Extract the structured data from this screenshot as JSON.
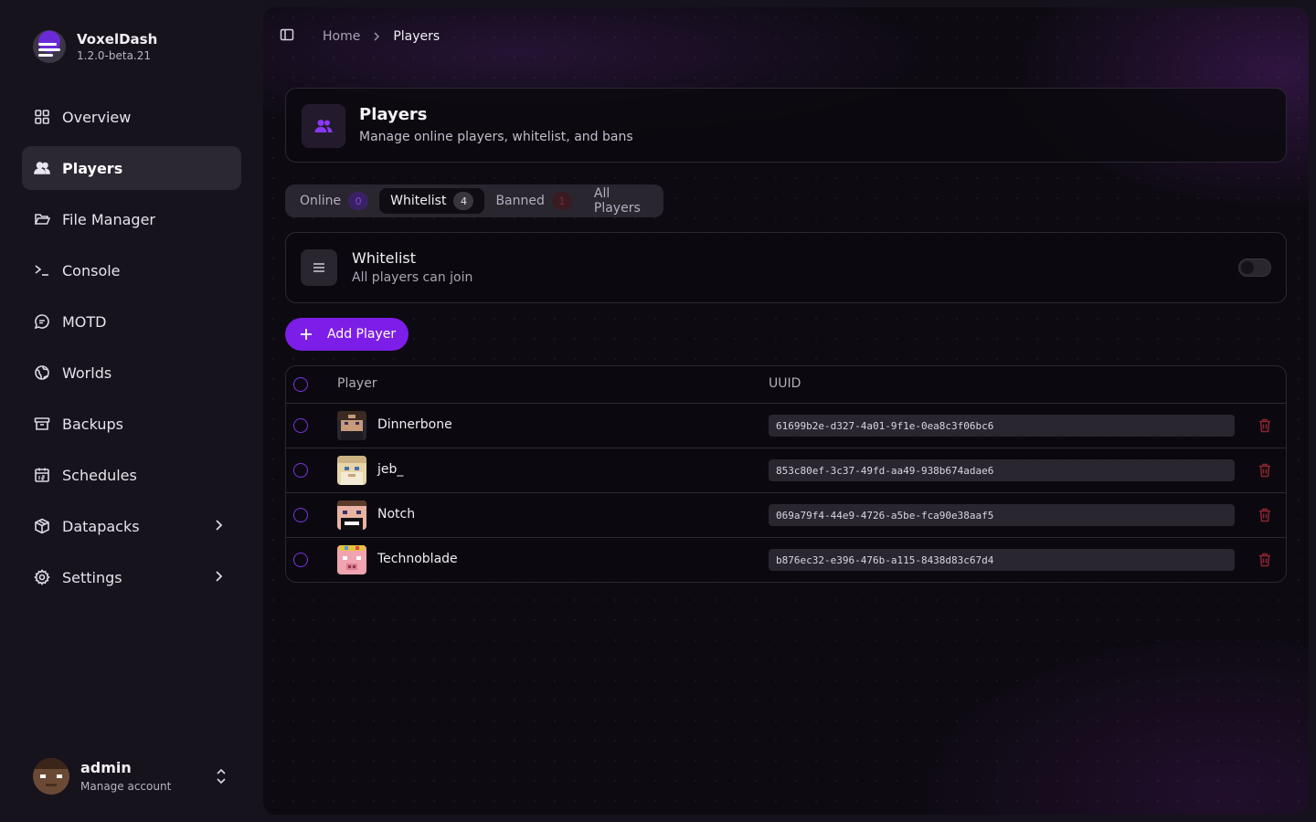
{
  "app": {
    "name": "VoxelDash",
    "version": "1.2.0-beta.21"
  },
  "sidebar": {
    "items": [
      {
        "label": "Overview",
        "icon": "grid-icon"
      },
      {
        "label": "Players",
        "icon": "users-icon",
        "active": true
      },
      {
        "label": "File Manager",
        "icon": "folder-icon"
      },
      {
        "label": "Console",
        "icon": "terminal-icon"
      },
      {
        "label": "MOTD",
        "icon": "message-icon"
      },
      {
        "label": "Worlds",
        "icon": "globe-icon"
      },
      {
        "label": "Backups",
        "icon": "archive-icon"
      },
      {
        "label": "Schedules",
        "icon": "calendar-icon"
      },
      {
        "label": "Datapacks",
        "icon": "package-icon",
        "has_submenu": true
      },
      {
        "label": "Settings",
        "icon": "gear-icon",
        "has_submenu": true
      }
    ],
    "account": {
      "name": "admin",
      "subtitle": "Manage account"
    }
  },
  "breadcrumb": {
    "home": "Home",
    "current": "Players"
  },
  "header": {
    "title": "Players",
    "subtitle": "Manage online players, whitelist, and bans"
  },
  "tabs": [
    {
      "label": "Online",
      "count": "0"
    },
    {
      "label": "Whitelist",
      "count": "4",
      "active": true
    },
    {
      "label": "Banned",
      "count": "1"
    },
    {
      "label": "All Players"
    }
  ],
  "whitelist": {
    "title": "Whitelist",
    "subtitle": "All players can join",
    "enabled": false
  },
  "add_button": {
    "label": "Add Player"
  },
  "table": {
    "columns": {
      "player": "Player",
      "uuid": "UUID"
    },
    "rows": [
      {
        "name": "Dinnerbone",
        "uuid": "61699b2e-d327-4a01-9f1e-0ea8c3f06bc6"
      },
      {
        "name": "jeb_",
        "uuid": "853c80ef-3c37-49fd-aa49-938b674adae6"
      },
      {
        "name": "Notch",
        "uuid": "069a79f4-44e9-4726-a5be-fca90e38aaf5"
      },
      {
        "name": "Technoblade",
        "uuid": "b876ec32-e396-476b-a115-8438d83c67d4"
      }
    ]
  },
  "colors": {
    "accent": "#7d1ee8",
    "danger": "#8c2430",
    "background": "#0d0a11"
  }
}
